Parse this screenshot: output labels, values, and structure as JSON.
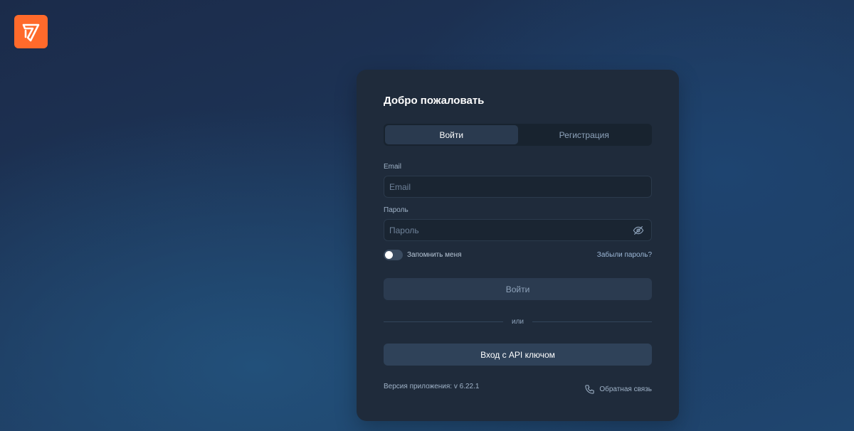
{
  "brand": {
    "logo_icon": "bolt-logo-icon",
    "accent_color": "#ff6a2b"
  },
  "card": {
    "title": "Добро пожаловать"
  },
  "tabs": [
    {
      "label": "Войти",
      "active": true
    },
    {
      "label": "Регистрация",
      "active": false
    }
  ],
  "form": {
    "email_label": "Email",
    "email_placeholder": "Email",
    "email_value": "",
    "password_label": "Пароль",
    "password_placeholder": "Пароль",
    "password_value": "",
    "password_toggle_icon": "eye-off-icon",
    "remember_label": "Запомнить меня",
    "remember_checked": false,
    "forgot_label": "Забыли пароль?",
    "submit_label": "Войти"
  },
  "divider_text": "или",
  "api_button_label": "Вход с API ключом",
  "footer": {
    "version_text": "Версия приложения: v 6.22.1",
    "feedback_label": "Обратная связь",
    "feedback_icon": "phone-icon"
  }
}
